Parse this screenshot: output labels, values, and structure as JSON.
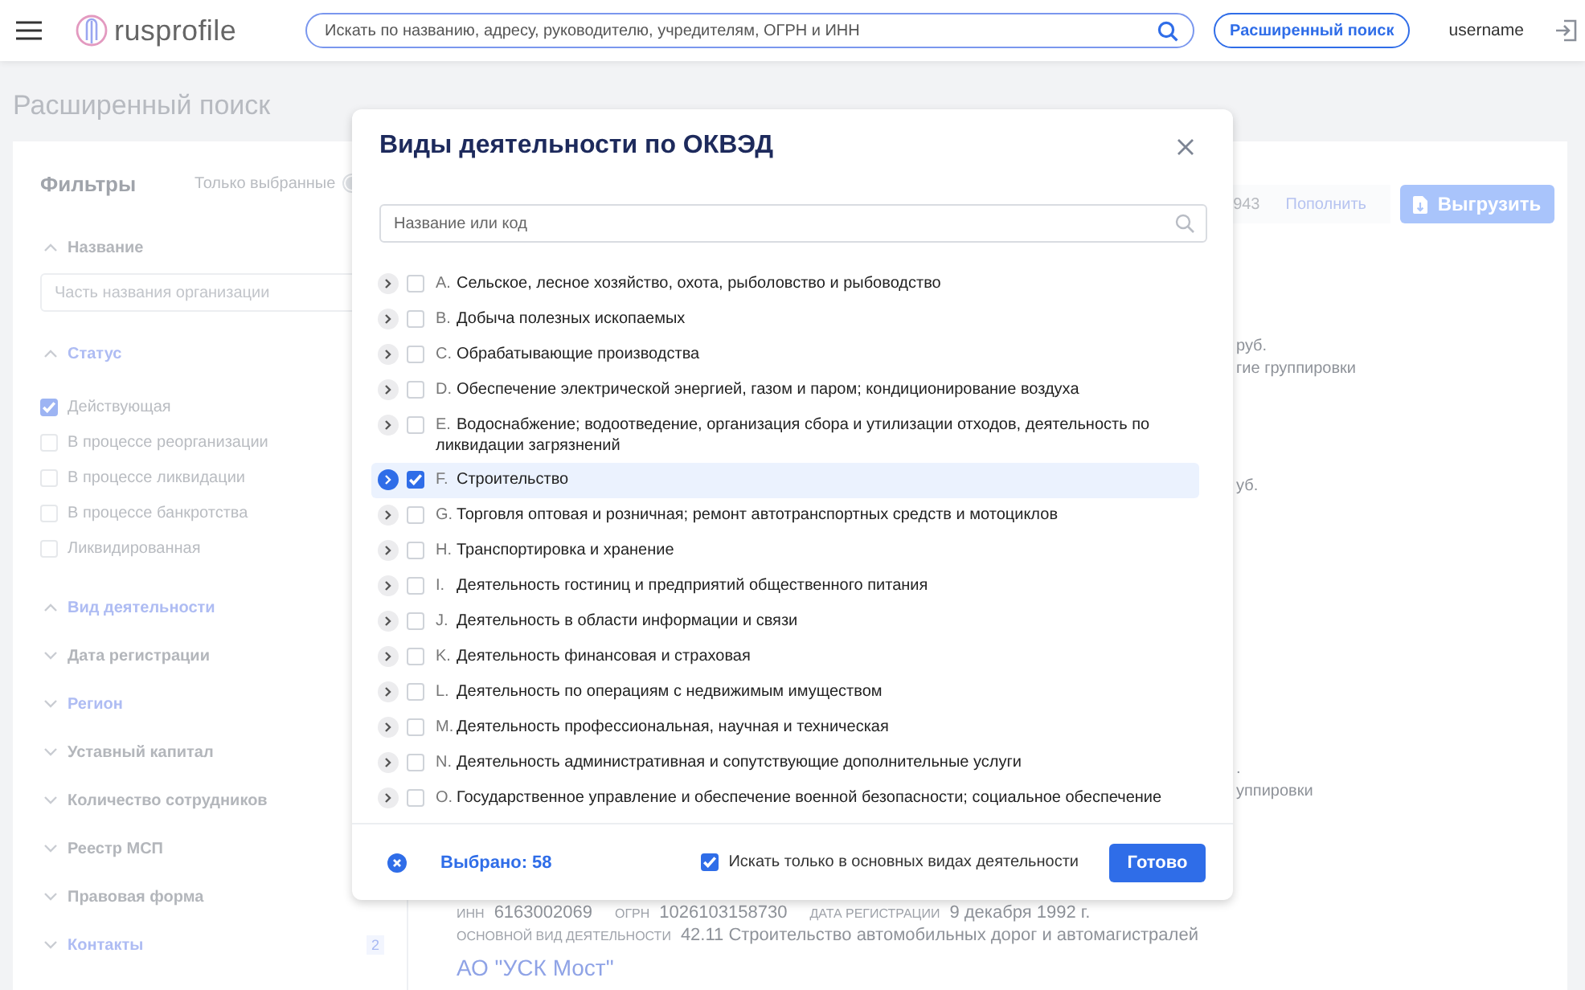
{
  "header": {
    "logo_text": "rusprofile",
    "search_placeholder": "Искать по названию, адресу, руководителю, учредителям, ОГРН и ИНН",
    "advanced_search": "Расширенный поиск",
    "username": "username"
  },
  "page_title": "Расширенный поиск",
  "filters": {
    "title": "Фильтры",
    "only_selected": "Только выбранные",
    "only_selected_on": false,
    "sections": [
      {
        "kind": "field",
        "label": "Название",
        "expanded": true,
        "applied": false,
        "placeholder": "Часть названия организации"
      },
      {
        "kind": "checklist",
        "label": "Статус",
        "expanded": true,
        "applied": true,
        "options": [
          {
            "label": "Действующая",
            "checked": true
          },
          {
            "label": "В процессе реорганизации",
            "checked": false
          },
          {
            "label": "В процессе ликвидации",
            "checked": false
          },
          {
            "label": "В процессе банкротства",
            "checked": false
          },
          {
            "label": "Ликвидированная",
            "checked": false
          }
        ]
      },
      {
        "label": "Вид деятельности",
        "expanded": true,
        "applied": true
      },
      {
        "label": "Дата регистрации",
        "expanded": false,
        "applied": false
      },
      {
        "label": "Регион",
        "expanded": false,
        "applied": true
      },
      {
        "label": "Уставный капитал",
        "expanded": false,
        "applied": false
      },
      {
        "label": "Количество сотрудников",
        "expanded": false,
        "applied": false
      },
      {
        "label": "Реестр МСП",
        "expanded": false,
        "applied": false
      },
      {
        "label": "Правовая форма",
        "expanded": false,
        "applied": false
      },
      {
        "label": "Контакты",
        "expanded": false,
        "applied": true,
        "badge": "2"
      }
    ]
  },
  "results": {
    "count": "943",
    "top_up": "Пополнить",
    "export": "Выгрузить",
    "fragments": [
      {
        "lines": [
          "руб.",
          "гие группировки"
        ]
      },
      {
        "lines": [
          "уб."
        ]
      },
      {
        "lines": [
          ".",
          "уппировки"
        ]
      }
    ],
    "company": {
      "fields": [
        {
          "label": "ИНН",
          "value": "6163002069"
        },
        {
          "label": "ОГРН",
          "value": "1026103158730"
        },
        {
          "label": "ДАТА РЕГИСТРАЦИИ",
          "value": "9 декабря 1992 г."
        }
      ],
      "activity_label": "ОСНОВНОЙ ВИД ДЕЯТЕЛЬНОСТИ",
      "activity": "42.11 Строительство автомобильных дорог и автомагистралей"
    },
    "next_company": "АО \"УСК Мост\""
  },
  "dialog": {
    "title": "Виды деятельности по ОКВЭД",
    "search_placeholder": "Название или код",
    "items": [
      {
        "code": "A.",
        "label": "Сельское, лесное хозяйство, охота, рыболовство и рыбоводство",
        "checked": false,
        "selected": false
      },
      {
        "code": "B.",
        "label": "Добыча полезных ископаемых",
        "checked": false,
        "selected": false
      },
      {
        "code": "C.",
        "label": "Обрабатывающие производства",
        "checked": false,
        "selected": false
      },
      {
        "code": "D.",
        "label": "Обеспечение электрической энергией, газом и паром; кондиционирование воздуха",
        "checked": false,
        "selected": false
      },
      {
        "code": "E.",
        "label": "Водоснабжение; водоотведение, организация сбора и утилизации отходов, деятельность по ликвидации загрязнений",
        "checked": false,
        "selected": false
      },
      {
        "code": "F.",
        "label": "Строительство",
        "checked": true,
        "selected": true
      },
      {
        "code": "G.",
        "label": "Торговля оптовая и розничная; ремонт автотранспортных средств и мотоциклов",
        "checked": false,
        "selected": false
      },
      {
        "code": "H.",
        "label": "Транспортировка и хранение",
        "checked": false,
        "selected": false
      },
      {
        "code": "I.",
        "label": "Деятельность гостиниц и предприятий общественного питания",
        "checked": false,
        "selected": false
      },
      {
        "code": "J.",
        "label": "Деятельность в области информации и связи",
        "checked": false,
        "selected": false
      },
      {
        "code": "K.",
        "label": "Деятельность финансовая и страховая",
        "checked": false,
        "selected": false
      },
      {
        "code": "L.",
        "label": "Деятельность по операциям с недвижимым имуществом",
        "checked": false,
        "selected": false
      },
      {
        "code": "M.",
        "label": "Деятельность профессиональная, научная и техническая",
        "checked": false,
        "selected": false
      },
      {
        "code": "N.",
        "label": "Деятельность административная и сопутствующие дополнительные услуги",
        "checked": false,
        "selected": false
      },
      {
        "code": "O.",
        "label": "Государственное управление и обеспечение военной безопасности; социальное обеспечение",
        "checked": false,
        "selected": false
      }
    ],
    "selected_count": "Выбрано: 58",
    "main_only": {
      "label": "Искать только в основных видах деятельности",
      "checked": true
    },
    "done": "Готово"
  }
}
